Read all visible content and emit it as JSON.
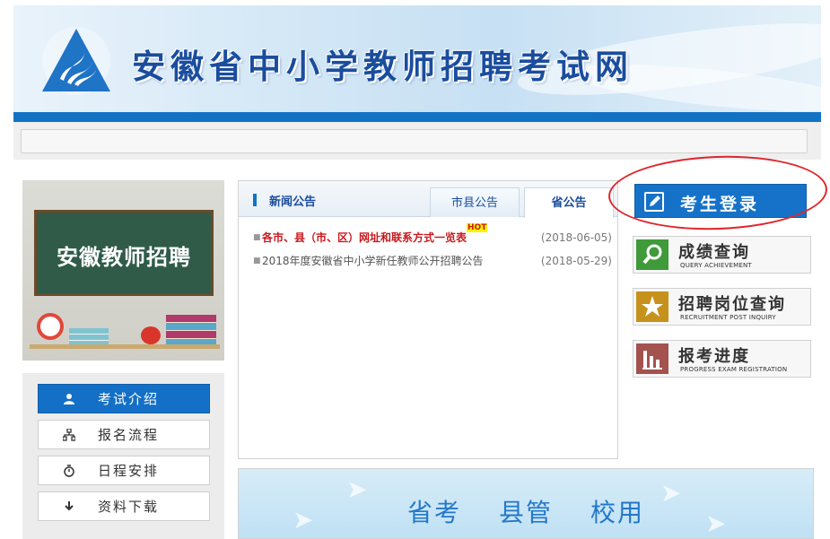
{
  "header": {
    "site_title": "安徽省中小学教师招聘考试网"
  },
  "left": {
    "photo_text": "安徽教师招聘",
    "menu": [
      {
        "label": "考试介绍",
        "icon": "user-icon",
        "active": true
      },
      {
        "label": "报名流程",
        "icon": "sitemap-icon",
        "active": false
      },
      {
        "label": "日程安排",
        "icon": "stopwatch-icon",
        "active": false
      },
      {
        "label": "资料下载",
        "icon": "download-icon",
        "active": false
      }
    ]
  },
  "news": {
    "title": "新闻公告",
    "tabs": [
      {
        "label": "市县公告",
        "active": false
      },
      {
        "label": "省公告",
        "active": true
      }
    ],
    "items": [
      {
        "title": "各市、县（市、区）网址和联系方式一览表",
        "hot": "HOT",
        "date": "(2018-06-05)"
      },
      {
        "title": "2018年度安徽省中小学新任教师公开招聘公告",
        "date": "(2018-05-29)"
      }
    ]
  },
  "right": {
    "login_label": "考生登录",
    "quick_links": [
      {
        "label": "成绩查询",
        "sub": "QUERY ACHIEVEMENT",
        "icon": "search-icon",
        "color": "#3f9a3a"
      },
      {
        "label": "招聘岗位查询",
        "sub": "RECRUITMENT POST INQUIRY",
        "icon": "star-icon",
        "color": "#c7921b"
      },
      {
        "label": "报考进度",
        "sub": "PROGRESS EXAM REGISTRATION",
        "icon": "bar-chart-icon",
        "color": "#a4524e"
      }
    ]
  },
  "bottom_banner": {
    "words": [
      "省考",
      "县管",
      "校用"
    ]
  },
  "colors": {
    "primary_blue": "#1273c4",
    "hot_red": "#c8191e",
    "annotation_red": "#e0252a"
  }
}
